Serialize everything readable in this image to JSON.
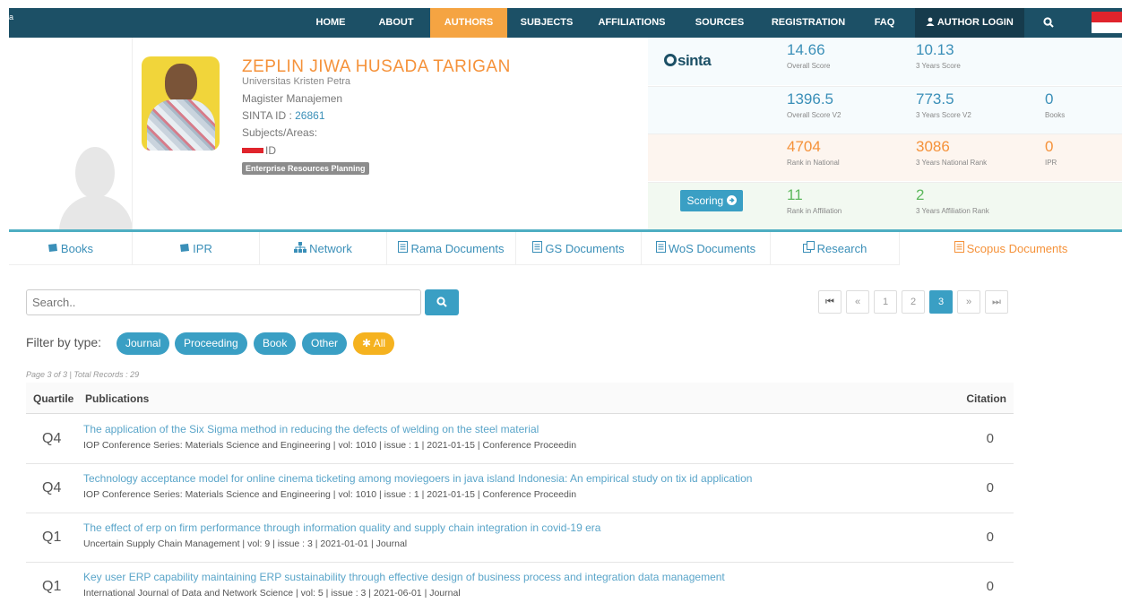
{
  "nav": {
    "brand_char": "a",
    "items": [
      {
        "label": "HOME"
      },
      {
        "label": "ABOUT"
      },
      {
        "label": "AUTHORS"
      },
      {
        "label": "SUBJECTS"
      },
      {
        "label": "AFFILIATIONS"
      },
      {
        "label": "SOURCES"
      },
      {
        "label": "REGISTRATION"
      },
      {
        "label": "FAQ"
      }
    ],
    "login_label": "AUTHOR LOGIN",
    "active_color": "#f5a442",
    "bar_color": "#1c5066"
  },
  "author": {
    "name": "ZEPLIN JIWA HUSADA TARIGAN",
    "university": "Universitas Kristen Petra",
    "program": "Magister Manajemen",
    "sinta_label": "SINTA ID : ",
    "sinta_id": "26861",
    "subjects_label": "Subjects/Areas:",
    "country": "ID",
    "subject_tag": "Enterprise Resources Planning"
  },
  "scores": {
    "logo_text": "sinta",
    "scoring_label": "Scoring",
    "overall": {
      "value": "14.66",
      "label": "Overall Score"
    },
    "three_years": {
      "value": "10.13",
      "label": "3 Years Score"
    },
    "overall_v2": {
      "value": "1396.5",
      "label": "Overall Score V2"
    },
    "three_years_v2": {
      "value": "773.5",
      "label": "3 Years Score V2"
    },
    "books": {
      "value": "0",
      "label": "Books"
    },
    "rank_national": {
      "value": "4704",
      "label": "Rank in National"
    },
    "three_years_national": {
      "value": "3086",
      "label": "3 Years National Rank"
    },
    "ipr": {
      "value": "0",
      "label": "IPR"
    },
    "rank_affiliation": {
      "value": "11",
      "label": "Rank in Affiliation"
    },
    "three_years_affiliation": {
      "value": "2",
      "label": "3 Years Affiliation Rank"
    }
  },
  "tabs": [
    {
      "label": "Books",
      "icon": "book-icon"
    },
    {
      "label": "IPR",
      "icon": "book-icon"
    },
    {
      "label": "Network",
      "icon": "sitemap-icon"
    },
    {
      "label": "Rama Documents",
      "icon": "document-icon"
    },
    {
      "label": "GS Documents",
      "icon": "document-icon"
    },
    {
      "label": "WoS Documents",
      "icon": "document-icon"
    },
    {
      "label": "Research",
      "icon": "copy-icon"
    },
    {
      "label": "Scopus Documents",
      "icon": "document-icon"
    }
  ],
  "search": {
    "placeholder": "Search.."
  },
  "pager": {
    "first": "⏮",
    "prev": "«",
    "pages": [
      "1",
      "2",
      "3"
    ],
    "current": "3",
    "next": "»",
    "last": "⏭"
  },
  "filter": {
    "label": "Filter by type:",
    "chips": [
      "Journal",
      "Proceeding",
      "Book",
      "Other"
    ],
    "all_label": "All"
  },
  "page_info": "Page 3 of 3 | Total Records : 29",
  "table": {
    "headers": {
      "quartile": "Quartile",
      "publications": "Publications",
      "citation": "Citation"
    },
    "rows": [
      {
        "quartile": "Q4",
        "title": "The application of the Six Sigma method in reducing the defects of welding on the steel material",
        "meta": "IOP Conference Series: Materials Science and Engineering | vol: 1010 | issue : 1 | 2021-01-15 | Conference Proceedin",
        "citation": "0"
      },
      {
        "quartile": "Q4",
        "title": "Technology acceptance model for online cinema ticketing among moviegoers in java island Indonesia: An empirical study on tix id application",
        "meta": "IOP Conference Series: Materials Science and Engineering | vol: 1010 | issue : 1 | 2021-01-15 | Conference Proceedin",
        "citation": "0"
      },
      {
        "quartile": "Q1",
        "title": "The effect of erp on firm performance through information quality and supply chain integration in covid-19 era",
        "meta": "Uncertain Supply Chain Management | vol: 9 | issue : 3 | 2021-01-01 | Journal",
        "citation": "0"
      },
      {
        "quartile": "Q1",
        "title": "Key user ERP capability maintaining ERP sustainability through effective design of business process and integration data management",
        "meta": "International Journal of Data and Network Science | vol: 5 | issue : 3 | 2021-06-01 | Journal",
        "citation": "0"
      }
    ]
  }
}
